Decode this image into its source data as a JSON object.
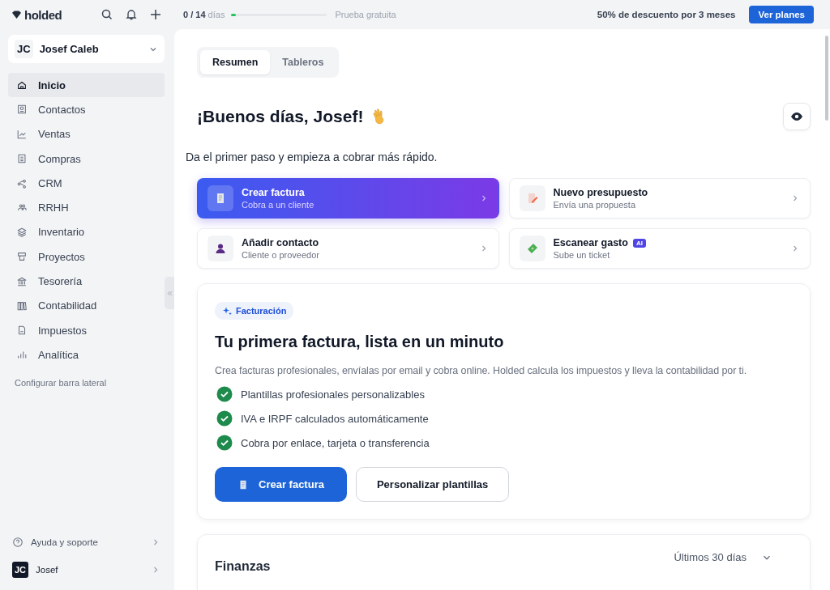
{
  "topbar": {
    "brand": "holded",
    "trial": {
      "count": "0 / 14",
      "unit": "días",
      "level": 0.05,
      "label": "Prueba gratuita"
    },
    "promo": "50% de descuento por 3 meses",
    "cta": "Ver planes"
  },
  "sidebar": {
    "account": {
      "initials": "JC",
      "name": "Josef Caleb"
    },
    "items": [
      {
        "label": "Inicio",
        "selected": true
      },
      {
        "label": "Contactos",
        "selected": false
      },
      {
        "label": "Ventas",
        "selected": false
      },
      {
        "label": "Compras",
        "selected": false
      },
      {
        "label": "CRM",
        "selected": false
      },
      {
        "label": "RRHH",
        "selected": false
      },
      {
        "label": "Inventario",
        "selected": false
      },
      {
        "label": "Proyectos",
        "selected": false
      },
      {
        "label": "Tesorería",
        "selected": false
      },
      {
        "label": "Contabilidad",
        "selected": false
      },
      {
        "label": "Impuestos",
        "selected": false
      },
      {
        "label": "Analítica",
        "selected": false
      }
    ],
    "configure": "Configurar barra lateral",
    "help": "Ayuda y soporte",
    "user": {
      "initials": "JC",
      "name": "Josef"
    }
  },
  "tabs": [
    {
      "label": "Resumen",
      "selected": true
    },
    {
      "label": "Tableros",
      "selected": false
    }
  ],
  "greeting": "¡Buenos días, Josef!",
  "subtitle": "Da el primer paso y empieza a cobrar más rápido.",
  "actions": [
    {
      "title": "Crear factura",
      "subtitle": "Cobra a un cliente",
      "selected": true
    },
    {
      "title": "Nuevo presupuesto",
      "subtitle": "Envía una propuesta",
      "selected": false
    },
    {
      "title": "Añadir contacto",
      "subtitle": "Cliente o proveedor",
      "selected": false
    },
    {
      "title": "Escanear gasto",
      "subtitle": "Sube un ticket",
      "badge": "AI",
      "selected": false
    }
  ],
  "promo_card": {
    "tag": "Facturación",
    "title": "Tu primera factura, lista en un minuto",
    "description": "Crea facturas profesionales, envíalas por email y cobra online. Holded calcula los impuestos y lleva la contabilidad por ti.",
    "features": [
      {
        "text": "Plantillas profesionales personalizables",
        "checked": true
      },
      {
        "text": "IVA e IRPF calculados automáticamente",
        "checked": true
      },
      {
        "text": "Cobra por enlace, tarjeta o transferencia",
        "checked": true
      }
    ],
    "primary": "Crear factura",
    "secondary": "Personalizar plantillas"
  },
  "finance": {
    "title": "Finanzas",
    "period": "Últimos 30 días"
  }
}
